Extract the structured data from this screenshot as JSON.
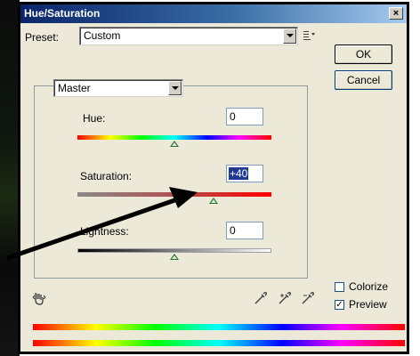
{
  "window": {
    "title": "Hue/Saturation",
    "close_label": "×"
  },
  "preset": {
    "label": "Preset:",
    "value": "Custom"
  },
  "buttons": {
    "ok": "OK",
    "cancel": "Cancel"
  },
  "channel": {
    "value": "Master"
  },
  "hue": {
    "label": "Hue:",
    "value": "0",
    "slider_fraction": 0.5
  },
  "saturation": {
    "label": "Saturation:",
    "value": "+40",
    "slider_fraction": 0.7
  },
  "lightness": {
    "label": "Lightness:",
    "value": "0",
    "slider_fraction": 0.5
  },
  "colorize": {
    "label": "Colorize",
    "checked": false
  },
  "preview": {
    "label": "Preview",
    "checked": true,
    "mark": "✓"
  },
  "colors": {
    "arrow": "#000000",
    "title_start": "#0a246a",
    "title_end": "#a6caf0"
  }
}
